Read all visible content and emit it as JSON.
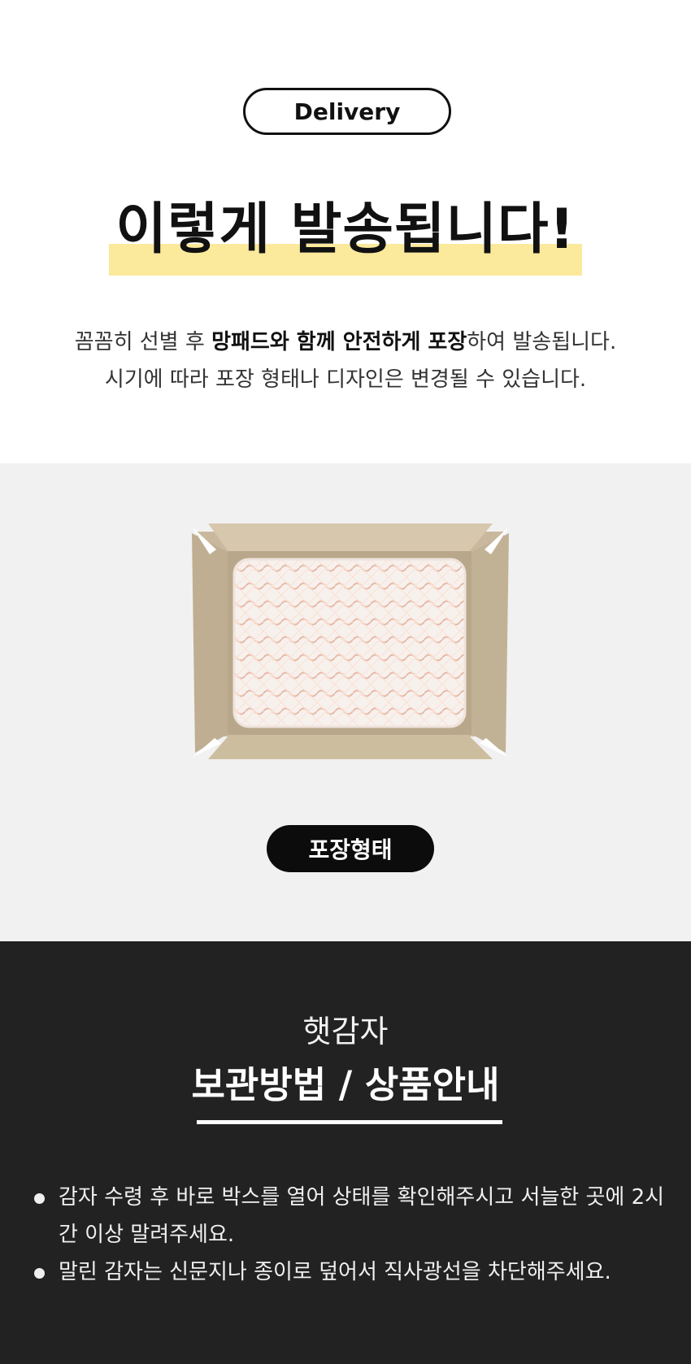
{
  "intro": {
    "pill_label": "Delivery",
    "headline": "이렇게 발송됩니다!",
    "highlight_color": "#fbe99c",
    "desc_line1_a": "꼼꼼히 선별 후 ",
    "desc_line1_b": "망패드와 함께 안전하게 포장",
    "desc_line1_c": "하여 발송됩니다.",
    "desc_line2": "시기에 따라 포장 형태나 디자인은 변경될 수 있습니다."
  },
  "package": {
    "image_icon": "cardboard-box-with-foam-net",
    "label": "포장형태"
  },
  "storage": {
    "subtitle": "햇감자",
    "title": "보관방법 / 상품안내",
    "notes": [
      "감자 수령 후 바로 박스를 열어 상태를 확인해주시고 서늘한 곳에 2시간 이상 말려주세요.",
      "말린 감자는 신문지나 종이로 덮어서 직사광선을 차단해주세요."
    ]
  }
}
